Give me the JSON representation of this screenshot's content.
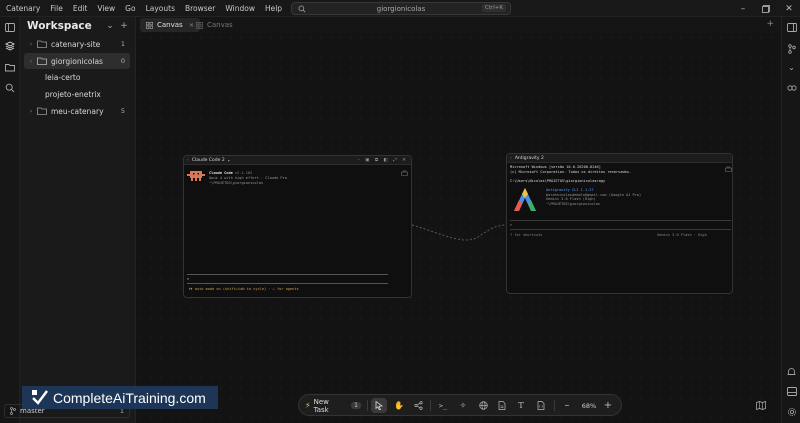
{
  "app": {
    "menu": [
      "Catenary",
      "File",
      "Edit",
      "View",
      "Go",
      "Layouts",
      "Browser",
      "Window",
      "Help"
    ],
    "search": {
      "text": "giorgionicolas",
      "shortcut": "Ctrl+K"
    }
  },
  "sidebar": {
    "title": "Workspace",
    "items": [
      {
        "label": "catenary-site",
        "count": "1",
        "expandable": true
      },
      {
        "label": "giorgionicolas",
        "count": "0",
        "expandable": true,
        "active": true
      },
      {
        "label": "leia-certo",
        "count": "",
        "expandable": false
      },
      {
        "label": "projeto-enetrix",
        "count": "",
        "expandable": false
      },
      {
        "label": "meu-catenary",
        "count": "5",
        "expandable": true
      }
    ],
    "branch": {
      "label": "master",
      "count": "1"
    }
  },
  "tabs": [
    {
      "label": "Canvas",
      "active": true
    },
    {
      "label": "Canvas",
      "active": false
    }
  ],
  "nodes": {
    "claude": {
      "title": "Claude Code 2",
      "app_name": "Claude Code",
      "version": "v2.1.162",
      "line2": "Opus 4 with high effort · Claude Pro",
      "line3": "~\\PROJETOS\\giorgionicolas",
      "prompt": ">",
      "footer": "⏵⏵ auto mode on (shift+tab to cycle) · ← for agents"
    },
    "antigravity": {
      "title": "Antigravity 2",
      "lines": [
        "Microsoft Windows [versão 10.0.26200.8246]",
        "(c) Microsoft Corporation. Todos os direitos reservados.",
        "",
        "C:\\Users\\Nicolas\\PROJETOS\\giorgionicolas>agy"
      ],
      "info": [
        "Antigravity CLI 1.1.27",
        "barahnicolasdemelo@gmail.com (Google AI Pro)",
        "Gemini 3.0 Flash (High)",
        "~\\PROJETOS\\giorgionicolas"
      ],
      "prompt": ">",
      "hint": "? for shortcuts",
      "model": "Gemini 3.0 Flash · High"
    }
  },
  "toolbar": {
    "new_task_label": "New Task",
    "new_task_count": "1",
    "zoom": "68%"
  },
  "watermark": "CompleteAiTraining.com",
  "colors": {
    "accent_orange": "#d97757",
    "active_tool": "#3a3a3a",
    "watermark_bg": "#1d3557"
  }
}
